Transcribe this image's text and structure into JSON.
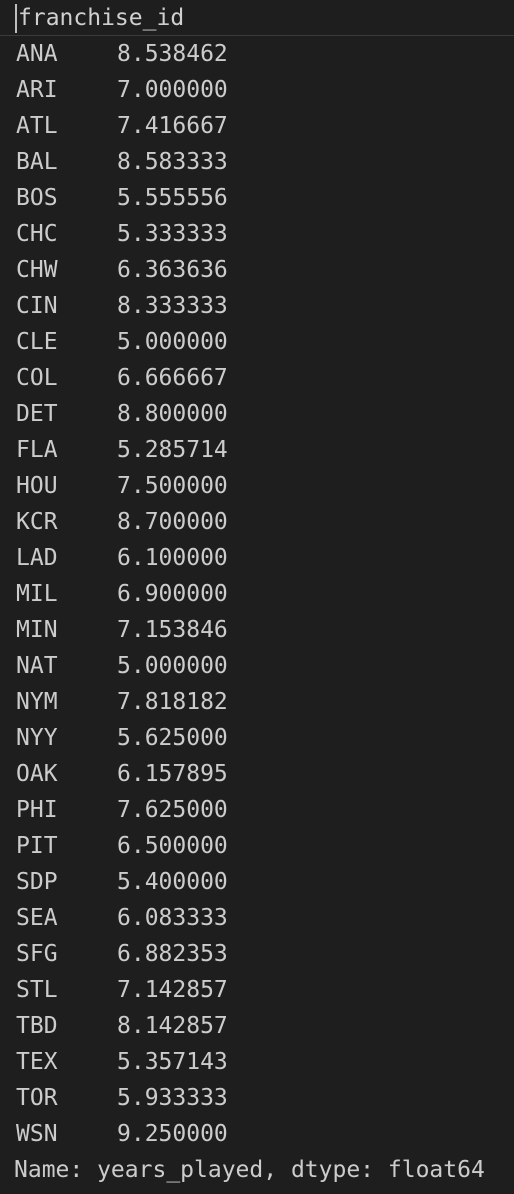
{
  "index_name": "franchise_id",
  "rows": [
    {
      "id": "ANA",
      "value": "8.538462"
    },
    {
      "id": "ARI",
      "value": "7.000000"
    },
    {
      "id": "ATL",
      "value": "7.416667"
    },
    {
      "id": "BAL",
      "value": "8.583333"
    },
    {
      "id": "BOS",
      "value": "5.555556"
    },
    {
      "id": "CHC",
      "value": "5.333333"
    },
    {
      "id": "CHW",
      "value": "6.363636"
    },
    {
      "id": "CIN",
      "value": "8.333333"
    },
    {
      "id": "CLE",
      "value": "5.000000"
    },
    {
      "id": "COL",
      "value": "6.666667"
    },
    {
      "id": "DET",
      "value": "8.800000"
    },
    {
      "id": "FLA",
      "value": "5.285714"
    },
    {
      "id": "HOU",
      "value": "7.500000"
    },
    {
      "id": "KCR",
      "value": "8.700000"
    },
    {
      "id": "LAD",
      "value": "6.100000"
    },
    {
      "id": "MIL",
      "value": "6.900000"
    },
    {
      "id": "MIN",
      "value": "7.153846"
    },
    {
      "id": "NAT",
      "value": "5.000000"
    },
    {
      "id": "NYM",
      "value": "7.818182"
    },
    {
      "id": "NYY",
      "value": "5.625000"
    },
    {
      "id": "OAK",
      "value": "6.157895"
    },
    {
      "id": "PHI",
      "value": "7.625000"
    },
    {
      "id": "PIT",
      "value": "6.500000"
    },
    {
      "id": "SDP",
      "value": "5.400000"
    },
    {
      "id": "SEA",
      "value": "6.083333"
    },
    {
      "id": "SFG",
      "value": "6.882353"
    },
    {
      "id": "STL",
      "value": "7.142857"
    },
    {
      "id": "TBD",
      "value": "8.142857"
    },
    {
      "id": "TEX",
      "value": "5.357143"
    },
    {
      "id": "TOR",
      "value": "5.933333"
    },
    {
      "id": "WSN",
      "value": "9.250000"
    }
  ],
  "footer": "Name: years_played, dtype: float64",
  "colors": {
    "background": "#1e1e1e",
    "text": "#cccccc",
    "cursor": "#bdbdbd"
  }
}
